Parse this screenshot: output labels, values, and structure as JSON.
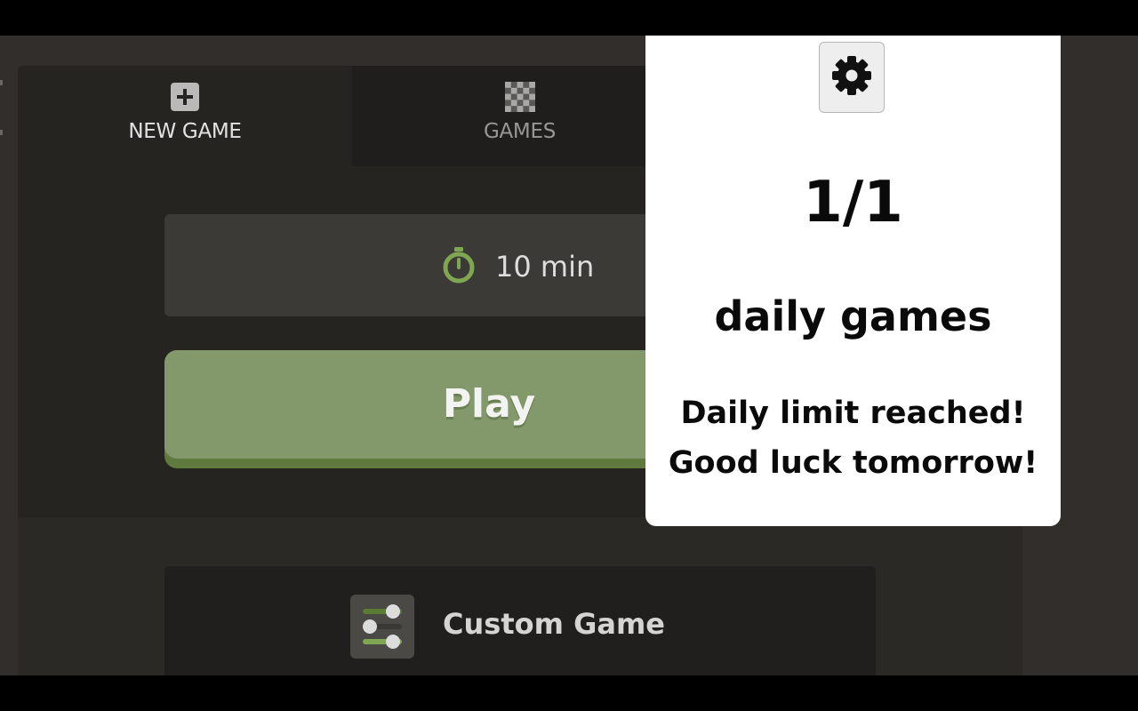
{
  "tabs": [
    {
      "label": "NEW GAME",
      "icon": "plus-square-icon",
      "active": true
    },
    {
      "label": "GAMES",
      "icon": "chessboard-icon",
      "active": false
    }
  ],
  "time_control": {
    "label": "10 min",
    "icon": "stopwatch-icon",
    "icon_color": "#7fa650"
  },
  "play_button": {
    "label": "Play",
    "color": "#83996b"
  },
  "custom_game": {
    "label": "Custom Game",
    "icon": "sliders-icon"
  },
  "popup": {
    "settings_icon": "gear-icon",
    "count": "1/1",
    "title": "daily games",
    "message_line1": "Daily limit reached!",
    "message_line2": "Good luck tomorrow!"
  },
  "colors": {
    "background": "#312e2b",
    "panel": "#262421",
    "accent_green": "#7fa650"
  }
}
